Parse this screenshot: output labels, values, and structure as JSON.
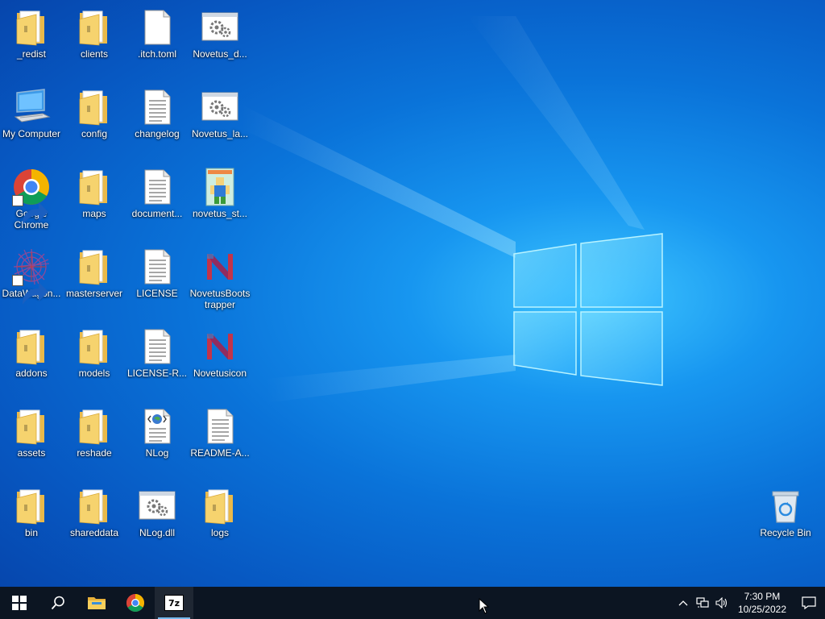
{
  "desktop": {
    "icons": [
      {
        "label": "_redist",
        "icon": "folder-icon"
      },
      {
        "label": "clients",
        "icon": "folder-icon"
      },
      {
        "label": ".itch.toml",
        "icon": "blank-file-icon"
      },
      {
        "label": "Novetus_d...",
        "icon": "settings-file-icon"
      },
      {
        "label": "My Computer",
        "icon": "computer-icon"
      },
      {
        "label": "config",
        "icon": "folder-icon"
      },
      {
        "label": "changelog",
        "icon": "text-file-icon"
      },
      {
        "label": "Novetus_la...",
        "icon": "settings-file-icon"
      },
      {
        "label": "Google Chrome",
        "icon": "chrome-icon"
      },
      {
        "label": "maps",
        "icon": "folder-icon"
      },
      {
        "label": "document...",
        "icon": "text-file-icon"
      },
      {
        "label": "novetus_st...",
        "icon": "image-file-icon"
      },
      {
        "label": "DataWagon...",
        "icon": "datawagon-icon"
      },
      {
        "label": "masterserver",
        "icon": "folder-icon"
      },
      {
        "label": "LICENSE",
        "icon": "text-file-icon"
      },
      {
        "label": "NovetusBootstrapper",
        "icon": "novetus-icon"
      },
      {
        "label": "addons",
        "icon": "folder-icon"
      },
      {
        "label": "models",
        "icon": "folder-icon"
      },
      {
        "label": "LICENSE-R...",
        "icon": "text-file-icon"
      },
      {
        "label": "Novetusicon",
        "icon": "novetus-icon"
      },
      {
        "label": "assets",
        "icon": "folder-icon"
      },
      {
        "label": "reshade",
        "icon": "folder-icon"
      },
      {
        "label": "NLog",
        "icon": "xml-file-icon"
      },
      {
        "label": "README-A...",
        "icon": "text-file-icon"
      },
      {
        "label": "bin",
        "icon": "folder-icon"
      },
      {
        "label": "shareddata",
        "icon": "folder-icon"
      },
      {
        "label": "NLog.dll",
        "icon": "settings-file-icon"
      },
      {
        "label": "logs",
        "icon": "folder-icon"
      }
    ],
    "recycle_bin": {
      "label": "Recycle Bin",
      "icon": "recycle-bin-icon"
    }
  },
  "taskbar": {
    "buttons": [
      "start-icon",
      "search-icon",
      "file-explorer-icon",
      "chrome-icon",
      "7zip-icon"
    ],
    "sevenzip_text": "7z",
    "tray": {
      "icons": [
        "chevron-up-icon",
        "network-icon",
        "volume-icon"
      ],
      "time": "7:30 PM",
      "date": "10/25/2022"
    }
  },
  "colors": {
    "taskbar_bg": "#0c1522",
    "desktop_bg": "#0a73d9",
    "folder": "#f5cf6b"
  }
}
